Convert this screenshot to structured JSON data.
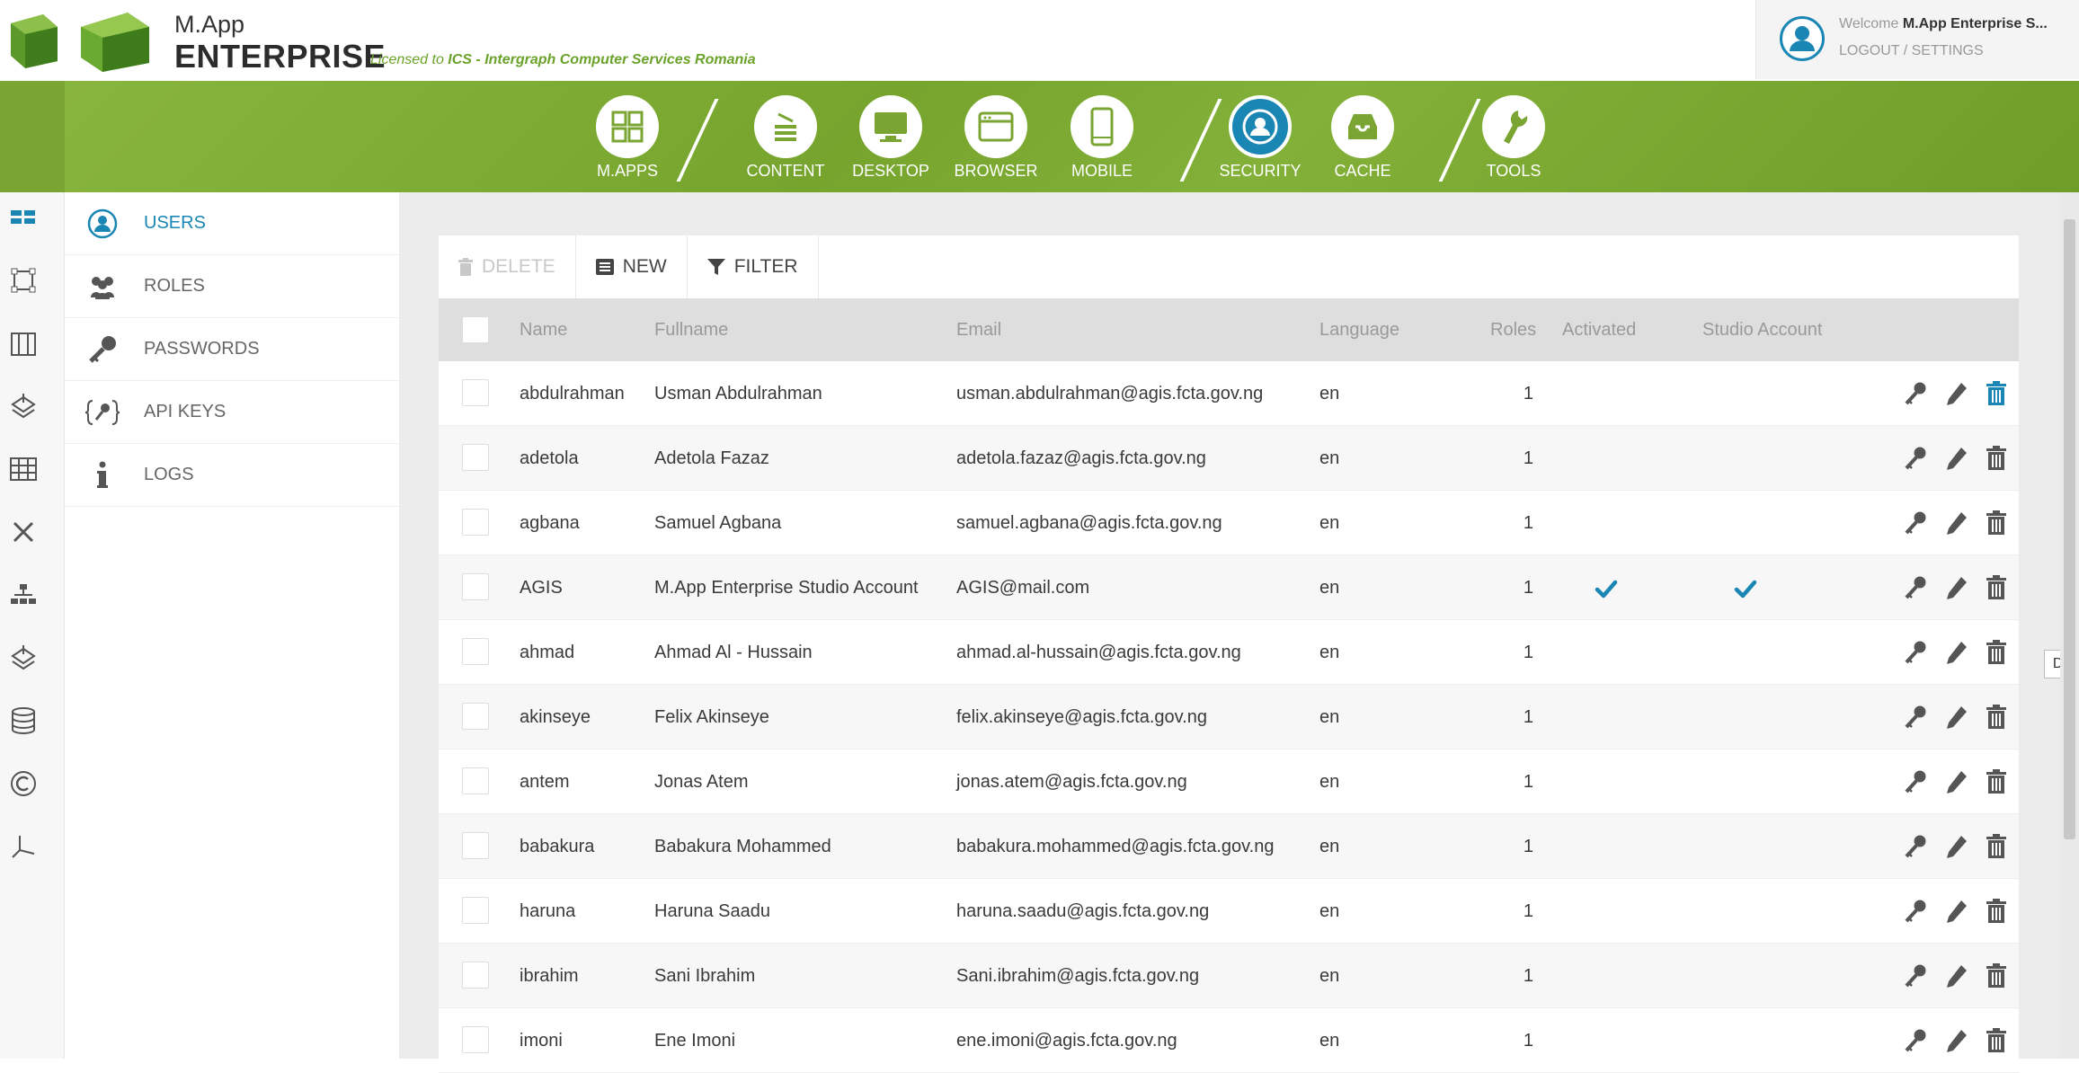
{
  "header": {
    "brand_small": "M.App",
    "brand_big": "ENTERPRISE",
    "license_prefix": "Licensed to",
    "license_org": "ICS - Intergraph Computer Services Romania",
    "welcome_prefix": "Welcome",
    "welcome_user": "M.App Enterprise S...",
    "user_links": "LOGOUT / SETTINGS"
  },
  "nav": {
    "items": [
      {
        "label": "M.APPS",
        "icon": "apps-grid-icon"
      },
      {
        "label": "CONTENT",
        "icon": "content-stack-icon"
      },
      {
        "label": "DESKTOP",
        "icon": "monitor-icon"
      },
      {
        "label": "BROWSER",
        "icon": "browser-window-icon"
      },
      {
        "label": "MOBILE",
        "icon": "mobile-phone-icon"
      },
      {
        "label": "SECURITY",
        "icon": "user-circle-icon"
      },
      {
        "label": "CACHE",
        "icon": "inbox-tray-icon"
      },
      {
        "label": "TOOLS",
        "icon": "wrench-icon"
      }
    ],
    "active": "SECURITY"
  },
  "sidebar": {
    "items": [
      {
        "label": "USERS",
        "icon": "user-circle-icon"
      },
      {
        "label": "ROLES",
        "icon": "users-group-icon"
      },
      {
        "label": "PASSWORDS",
        "icon": "key-icon"
      },
      {
        "label": "API KEYS",
        "icon": "api-key-icon"
      },
      {
        "label": "LOGS",
        "icon": "info-icon"
      }
    ],
    "active": "USERS"
  },
  "toolbar": {
    "delete_label": "DELETE",
    "new_label": "NEW",
    "filter_label": "FILTER"
  },
  "table": {
    "columns": [
      "Name",
      "Fullname",
      "Email",
      "Language",
      "Roles",
      "Activated",
      "Studio Account"
    ],
    "rows": [
      {
        "name": "abdulrahman",
        "fullname": "Usman Abdulrahman",
        "email": "usman.abdulrahman@agis.fcta.gov.ng",
        "language": "en",
        "roles": "1",
        "activated": false,
        "studio": false
      },
      {
        "name": "adetola",
        "fullname": "Adetola Fazaz",
        "email": "adetola.fazaz@agis.fcta.gov.ng",
        "language": "en",
        "roles": "1",
        "activated": false,
        "studio": false
      },
      {
        "name": "agbana",
        "fullname": "Samuel Agbana",
        "email": "samuel.agbana@agis.fcta.gov.ng",
        "language": "en",
        "roles": "1",
        "activated": false,
        "studio": false
      },
      {
        "name": "AGIS",
        "fullname": "M.App Enterprise Studio Account",
        "email": "AGIS@mail.com",
        "language": "en",
        "roles": "1",
        "activated": true,
        "studio": true
      },
      {
        "name": "ahmad",
        "fullname": "Ahmad Al - Hussain",
        "email": "ahmad.al-hussain@agis.fcta.gov.ng",
        "language": "en",
        "roles": "1",
        "activated": false,
        "studio": false
      },
      {
        "name": "akinseye",
        "fullname": "Felix Akinseye",
        "email": "felix.akinseye@agis.fcta.gov.ng",
        "language": "en",
        "roles": "1",
        "activated": false,
        "studio": false
      },
      {
        "name": "antem",
        "fullname": "Jonas Atem",
        "email": "jonas.atem@agis.fcta.gov.ng",
        "language": "en",
        "roles": "1",
        "activated": false,
        "studio": false
      },
      {
        "name": "babakura",
        "fullname": "Babakura Mohammed",
        "email": "babakura.mohammed@agis.fcta.gov.ng",
        "language": "en",
        "roles": "1",
        "activated": false,
        "studio": false
      },
      {
        "name": "haruna",
        "fullname": "Haruna Saadu",
        "email": "haruna.saadu@agis.fcta.gov.ng",
        "language": "en",
        "roles": "1",
        "activated": false,
        "studio": false
      },
      {
        "name": "ibrahim",
        "fullname": "Sani Ibrahim",
        "email": "Sani.ibrahim@agis.fcta.gov.ng",
        "language": "en",
        "roles": "1",
        "activated": false,
        "studio": false
      },
      {
        "name": "imoni",
        "fullname": "Ene Imoni",
        "email": "ene.imoni@agis.fcta.gov.ng",
        "language": "en",
        "roles": "1",
        "activated": false,
        "studio": false
      }
    ]
  },
  "tooltip": "Delete",
  "colors": {
    "brand_green": "#7aa532",
    "accent_blue": "#1a86b4",
    "check_blue": "#1a86b4"
  }
}
